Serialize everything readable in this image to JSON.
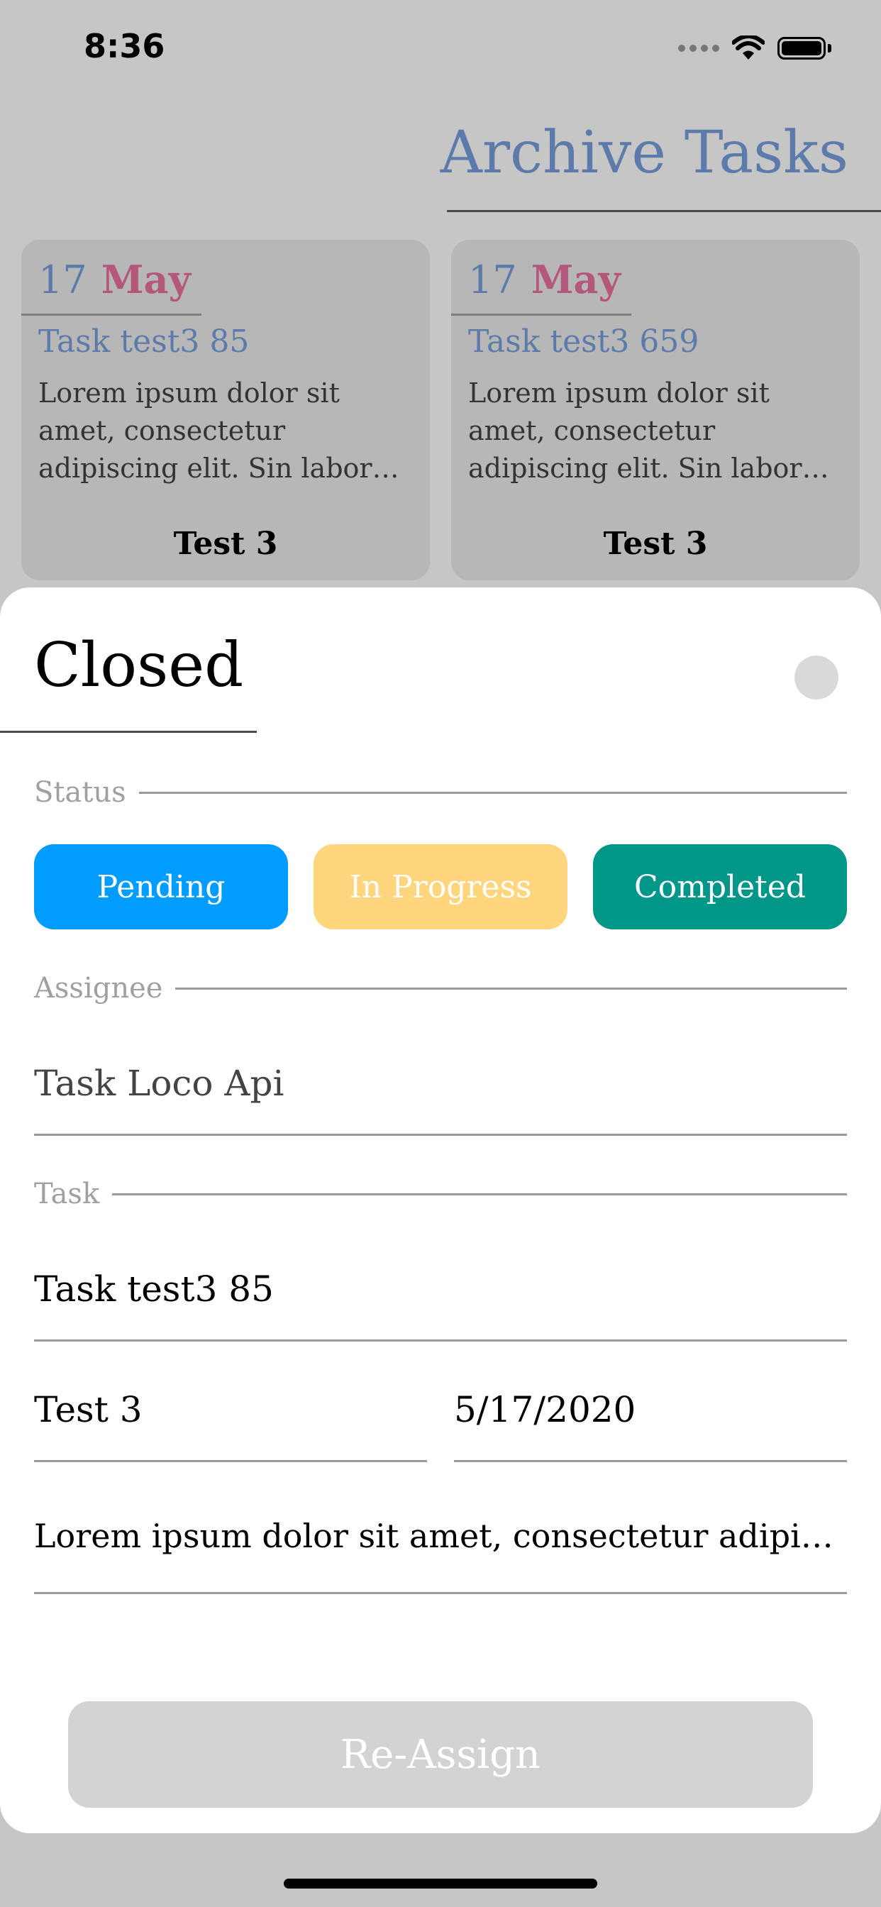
{
  "status_bar": {
    "time": "8:36"
  },
  "header": {
    "title": "Archive Tasks"
  },
  "cards": [
    {
      "day": "17",
      "month": "May",
      "title": "Task test3 85",
      "desc_lines": [
        "Lorem ipsum dolor sit",
        "amet, consectetur",
        "adipiscing elit. Sin labor…"
      ],
      "label": "Test 3"
    },
    {
      "day": "17",
      "month": "May",
      "title": "Task test3 659",
      "desc_lines": [
        "Lorem ipsum dolor sit",
        "amet, consectetur",
        "adipiscing elit. Sin labor…"
      ],
      "label": "Test 3"
    }
  ],
  "sheet": {
    "title": "Closed",
    "status_label": "Status",
    "status_buttons": [
      {
        "label": "Pending",
        "color": "#009cff"
      },
      {
        "label": "In Progress",
        "color": "#ffd57e"
      },
      {
        "label": "Completed",
        "color": "#009688"
      }
    ],
    "assignee_label": "Assignee",
    "assignee_value": "Task Loco Api",
    "task_label": "Task",
    "task_value": "Task test3 85",
    "project_value": "Test 3",
    "date_value": "5/17/2020",
    "description_value": "Lorem ipsum dolor sit amet, consectetur adipiscin…",
    "reassign_label": "Re-Assign"
  }
}
